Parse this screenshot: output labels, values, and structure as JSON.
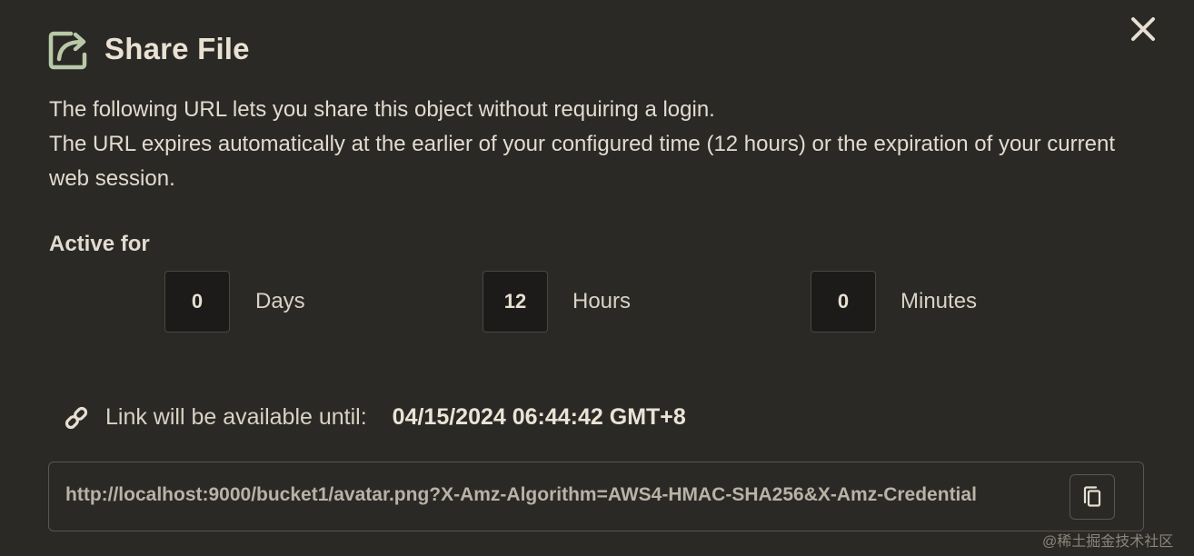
{
  "dialog": {
    "title": "Share File",
    "description_line1": "The following URL lets you share this object without requiring a login.",
    "description_line2": "The URL expires automatically at the earlier of your configured time (12 hours) or the expiration of your current web session."
  },
  "active_for": {
    "label": "Active for",
    "days": {
      "value": "0",
      "label": "Days"
    },
    "hours": {
      "value": "12",
      "label": "Hours"
    },
    "minutes": {
      "value": "0",
      "label": "Minutes"
    }
  },
  "availability": {
    "label": "Link will be available until:",
    "date": "04/15/2024 06:44:42 GMT+8"
  },
  "share_url": {
    "value": "http://localhost:9000/bucket1/avatar.png?X-Amz-Algorithm=AWS4-HMAC-SHA256&X-Amz-Credential"
  },
  "watermark": "@稀土掘金技术社区",
  "icons": {
    "title": "share-icon",
    "close": "close-icon",
    "link": "link-icon",
    "copy": "copy-icon"
  },
  "colors": {
    "background": "#2b2926",
    "icon_accent": "#b9c9a8",
    "input_bg": "#1c1b19",
    "text": "#e6dfd2"
  }
}
